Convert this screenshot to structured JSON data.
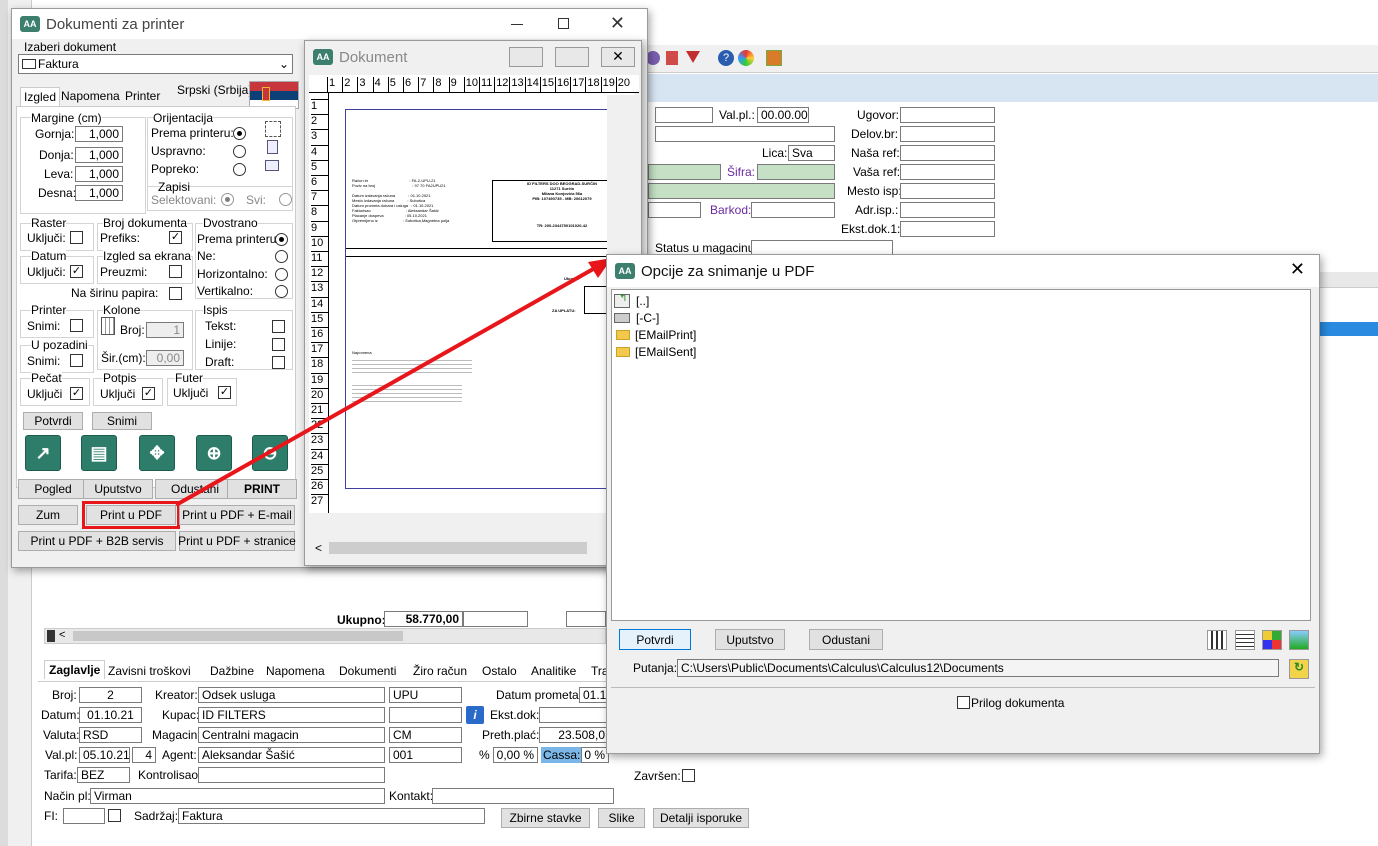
{
  "bg": {
    "fields_right": {
      "val_pl_label": "Val.pl.:",
      "val_pl": "00.00.00",
      "ugovor": "Ugovor:",
      "delov": "Delov.br:",
      "lica_label": "Lica:",
      "lica": "Sva",
      "nasa": "Naša ref:",
      "sifra": "Šifra:",
      "vasa": "Vaša ref:",
      "mesto": "Mesto isp:",
      "barkod": "Barkod:",
      "adr": "Adr.isp.:",
      "ekst1": "Ekst.dok.1:",
      "status": "Status u magacinu:"
    },
    "ukupno_label": "Ukupno:",
    "ukupno": "58.770,00",
    "tabs": [
      "Zaglavlje",
      "Zavisni troškovi",
      "Dažbine",
      "Napomena",
      "Dokumenti",
      "Žiro račun",
      "Ostalo",
      "Analitike",
      "Tra"
    ],
    "form": {
      "broj_l": "Broj:",
      "broj": "2",
      "kreator_l": "Kreator:",
      "kreator": "Odsek usluga",
      "upu": "UPU",
      "datum_prometa_l": "Datum prometa:",
      "datum_prometa": "01.1",
      "datum_l": "Datum:",
      "datum": "01.10.21",
      "kupac_l": "Kupac:",
      "kupac": "ID FILTERS",
      "ekst_l": "Ekst.dok:",
      "valuta_l": "Valuta:",
      "valuta": "RSD",
      "magacin_l": "Magacin:",
      "magacin": "Centralni magacin",
      "cm": "CM",
      "preth_l": "Preth.plać:",
      "preth": "23.508,0",
      "valpl_l": "Val.pl:",
      "valpl": "05.10.21",
      "valpl_n": "4",
      "agent_l": "Agent:",
      "agent": "Aleksandar Šašić",
      "agent_code": "001",
      "pct": "%",
      "pct_val": "0,00 %",
      "cassa": "Cassa:",
      "cassa_val": "0 %",
      "tarifa_l": "Tarifa:",
      "tarifa": "BEZ",
      "kontrolisao_l": "Kontrolisao:",
      "zavrsen": "Završen:",
      "nacin_l": "Način pl:",
      "nacin": "Virman",
      "kontakt_l": "Kontakt:",
      "fi_l": "FI:",
      "sadrzaj_l": "Sadržaj:",
      "sadrzaj": "Faktura",
      "zbirne": "Zbirne stavke",
      "slike": "Slike",
      "detalji": "Detalji isporuke"
    }
  },
  "printer": {
    "title": "Dokumenti za printer",
    "izaberi": "Izaberi dokument",
    "dokument": "Faktura",
    "tabs": [
      "Izgled",
      "Napomena",
      "Printer"
    ],
    "lang": "Srpski (Srbija)",
    "margine": "Margine (cm)",
    "gornja_l": "Gornja:",
    "gornja": "1,000",
    "donja_l": "Donja:",
    "donja": "1,000",
    "leva_l": "Leva:",
    "leva": "1,000",
    "desna_l": "Desna:",
    "desna": "1,000",
    "orij": "Orijentacija",
    "prema": "Prema printeru:",
    "uspravno": "Uspravno:",
    "popreko": "Popreko:",
    "zapisi": "Zapisi",
    "selekt": "Selektovani:",
    "svi": "Svi:",
    "raster": "Raster",
    "ukljuci": "Uključi:",
    "brojdok": "Broj dokumenta",
    "prefiks": "Prefiks:",
    "dvostrano": "Dvostrano",
    "prema2": "Prema printeru:",
    "ne": "Ne:",
    "horiz": "Horizontalno:",
    "vert": "Vertikalno:",
    "datum": "Datum",
    "izgled_ekr": "Izgled sa ekrana",
    "preuzmi": "Preuzmi:",
    "na_sirinu": "Na širinu papira:",
    "printer_g": "Printer",
    "snimi": "Snimi:",
    "kolone": "Kolone",
    "broj": "Broj:",
    "broj_v": "1",
    "sir": "Šir.(cm):",
    "sir_v": "0,00",
    "ispis": "Ispis",
    "tekst": "Tekst:",
    "linije": "Linije:",
    "draft": "Draft:",
    "u_poz": "U pozadini",
    "pecat": "Pečat",
    "potpis": "Potpis",
    "futer": "Futer",
    "ukljuci2": "Uključi",
    "potvrdi": "Potvrdi",
    "snimi_btn": "Snimi",
    "pogled": "Pogled",
    "uputstvo": "Uputstvo",
    "odustani": "Odustani",
    "print": "PRINT",
    "zum": "Zum",
    "print_pdf": "Print u PDF",
    "print_pdf_email": "Print u PDF + E-mail",
    "print_b2b": "Print u PDF + B2B servis",
    "print_stranice": "Print u PDF + stranice"
  },
  "preview": {
    "title": "Dokument",
    "ruler_h": [
      "1",
      "2",
      "3",
      "4",
      "5",
      "6",
      "7",
      "8",
      "9",
      "10",
      "11",
      "12",
      "13",
      "14",
      "15",
      "16",
      "17",
      "18",
      "19",
      "20"
    ],
    "ruler_v": [
      "1",
      "2",
      "3",
      "4",
      "5",
      "6",
      "7",
      "8",
      "9",
      "10",
      "11",
      "12",
      "13",
      "14",
      "15",
      "16",
      "17",
      "18",
      "19",
      "20",
      "21",
      "22",
      "23",
      "24",
      "25",
      "26",
      "27"
    ],
    "doc": {
      "racun": "Račun br",
      "racun_v": ": FA-2-UPU-21",
      "poziv": "Poziv na broj",
      "poziv_v": ": 97 70 FA2UPU21",
      "datum_iz": "Datum izdavanja računa",
      "datum_iz_v": ": 01.10.2021",
      "mesto": "Mesto izdavanja računa",
      "mesto_v": ": Subotica",
      "datum_pr": "Datum prometa dobara i usluga",
      "datum_pr_v": ": 01.10.2021",
      "fakt": "Fakturisao",
      "fakt_v": ": Aleksandar Šašić",
      "placanje": "Plaćanje dospeva",
      "placanje_v": ": 05.10.2021",
      "otprem": "Otpremljeno iz",
      "otprem_v": ": Subotica,Magnetna polja",
      "firma": "ID FILTERS DOO BEOGRAD-SURČIN",
      "firma2": "11271 Surčin",
      "firma3": "Milana Konjovića 56a",
      "firma4": "PIB: 107490735 - MB: 20612079",
      "firma5": "TR: 200-2344750101020-42",
      "ukupno": "Ukupno",
      "za_uplatu": "ZA UPLATU:",
      "napomena": "Napomena"
    }
  },
  "pdf": {
    "title": "Opcije za snimanje u PDF",
    "items": [
      "[..]",
      "[-C-]",
      "[EMailPrint]",
      "[EMailSent]"
    ],
    "potvrdi": "Potvrdi",
    "uputstvo": "Uputstvo",
    "odustani": "Odustani",
    "putanja_l": "Putanja:",
    "putanja": "C:\\Users\\Public\\Documents\\Calculus\\Calculus12\\Documents",
    "prilog": "Prilog dokumenta"
  },
  "annotation": {
    "color": "#e8161b"
  }
}
